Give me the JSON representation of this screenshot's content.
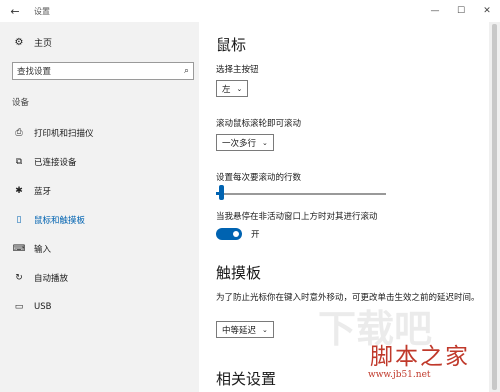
{
  "window": {
    "title": "设置",
    "back_icon": "←",
    "minimize_icon": "—",
    "maximize_icon": "☐",
    "close_icon": "✕"
  },
  "sidebar": {
    "home_icon": "⚙",
    "home_label": "主页",
    "search_placeholder": "查找设置",
    "search_icon": "⌕",
    "section_label": "设备",
    "items": [
      {
        "icon": "⎙",
        "label": "打印机和扫描仪"
      },
      {
        "icon": "⧉",
        "label": "已连接设备"
      },
      {
        "icon": "✱",
        "label": "蓝牙"
      },
      {
        "icon": "▯",
        "label": "鼠标和触摸板"
      },
      {
        "icon": "⌨",
        "label": "输入"
      },
      {
        "icon": "↻",
        "label": "自动播放"
      },
      {
        "icon": "▭",
        "label": "USB"
      }
    ],
    "active_index": 3
  },
  "main": {
    "mouse_heading": "鼠标",
    "primary_button_label": "选择主按钮",
    "primary_button_value": "左",
    "scroll_label": "滚动鼠标滚轮即可滚动",
    "scroll_value": "一次多行",
    "lines_label": "设置每次要滚动的行数",
    "lines_slider_fraction": 0.02,
    "inactive_scroll_label": "当我悬停在非活动窗口上方时对其进行滚动",
    "inactive_scroll_state": "开",
    "touchpad_heading": "触摸板",
    "touchpad_desc": "为了防止光标你在键入时意外移动，可更改单击生效之前的延迟时间。",
    "touchpad_delay_value": "中等延迟",
    "related_heading": "相关设置",
    "chevron_icon": "⌄"
  },
  "watermark": {
    "background": "下载吧",
    "title": "脚本之家",
    "url": "www.jb51.net"
  },
  "colors": {
    "accent": "#0063b1",
    "sidebar_bg": "#f2f2f2",
    "watermark": "#c0392b"
  }
}
